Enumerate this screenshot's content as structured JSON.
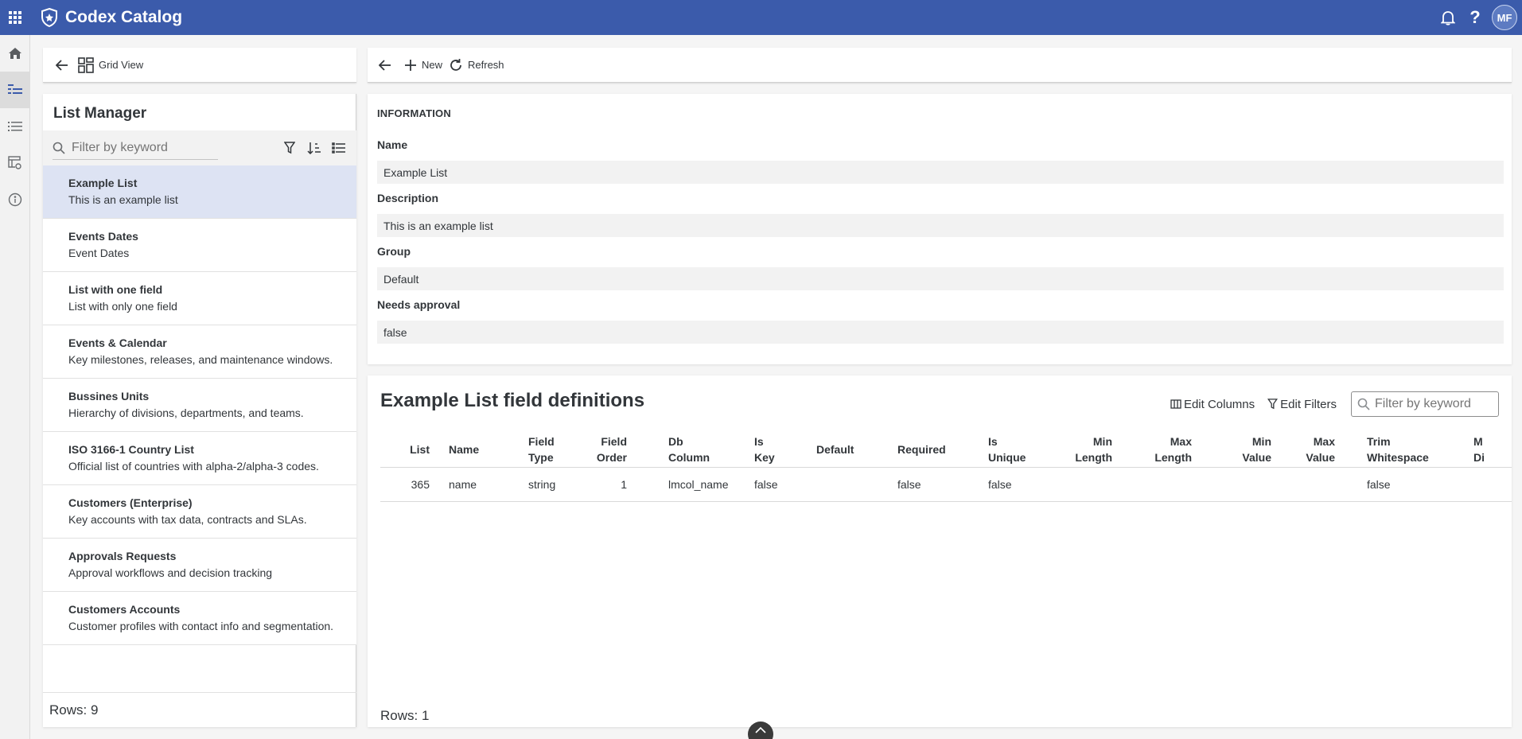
{
  "shell": {
    "title": "Codex Catalog",
    "avatar_initials": "MF",
    "bar_color": "#3b5bab"
  },
  "sidenav": {
    "items": [
      {
        "icon": "home-icon"
      },
      {
        "icon": "list-detail-icon",
        "active": true
      },
      {
        "icon": "bulleted-list-icon"
      },
      {
        "icon": "table-settings-icon"
      },
      {
        "icon": "info-icon"
      }
    ]
  },
  "left_toolbar": {
    "grid_view_label": "Grid View"
  },
  "list_manager": {
    "title": "List Manager",
    "search_placeholder": "Filter by keyword",
    "items": [
      {
        "title": "Example List",
        "desc": "This is an example list",
        "selected": true
      },
      {
        "title": "Events Dates",
        "desc": "Event Dates"
      },
      {
        "title": "List with one field",
        "desc": "List with only one field"
      },
      {
        "title": "Events & Calendar",
        "desc": "Key milestones, releases, and maintenance windows."
      },
      {
        "title": "Bussines Units",
        "desc": "Hierarchy of divisions, departments, and teams."
      },
      {
        "title": "ISO 3166-1 Country List",
        "desc": "Official list of countries with alpha-2/alpha-3 codes."
      },
      {
        "title": "Customers (Enterprise)",
        "desc": "Key accounts with tax data, contracts and SLAs."
      },
      {
        "title": "Approvals Requests",
        "desc": "Approval workflows and decision tracking"
      },
      {
        "title": "Customers Accounts",
        "desc": "Customer profiles with contact info and segmentation."
      }
    ],
    "footer": "Rows: 9"
  },
  "right_toolbar": {
    "new_label": "New",
    "refresh_label": "Refresh"
  },
  "information": {
    "heading": "INFORMATION",
    "fields": [
      {
        "label": "Name",
        "value": "Example List"
      },
      {
        "label": "Description",
        "value": "This is an example list"
      },
      {
        "label": "Group",
        "value": "Default"
      },
      {
        "label": "Needs approval",
        "value": "false"
      }
    ]
  },
  "definitions": {
    "title": "Example List field definitions",
    "edit_columns_label": "Edit Columns",
    "edit_filters_label": "Edit Filters",
    "search_placeholder": "Filter by keyword",
    "columns": [
      {
        "line1": "List",
        "line2": ""
      },
      {
        "line1": "Name",
        "line2": ""
      },
      {
        "line1": "Field",
        "line2": "Type"
      },
      {
        "line1": "Field",
        "line2": "Order"
      },
      {
        "line1": "Db",
        "line2": "Column"
      },
      {
        "line1": "Is",
        "line2": "Key"
      },
      {
        "line1": "Default",
        "line2": ""
      },
      {
        "line1": "Required",
        "line2": ""
      },
      {
        "line1": "Is",
        "line2": "Unique"
      },
      {
        "line1": "Min",
        "line2": "Length"
      },
      {
        "line1": "Max",
        "line2": "Length"
      },
      {
        "line1": "Min",
        "line2": "Value"
      },
      {
        "line1": "Max",
        "line2": "Value"
      },
      {
        "line1": "Trim",
        "line2": "Whitespace"
      },
      {
        "line1": "M",
        "line2": "Di"
      }
    ],
    "rows": [
      [
        "365",
        "name",
        "string",
        "1",
        "lmcol_name",
        "false",
        "",
        "false",
        "false",
        "",
        "",
        "",
        "",
        "false",
        ""
      ]
    ],
    "footer": "Rows: 1"
  }
}
